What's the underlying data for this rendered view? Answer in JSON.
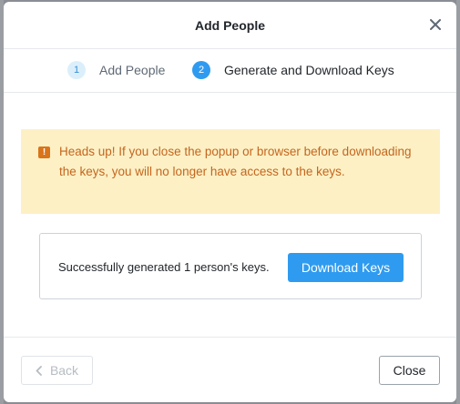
{
  "modal": {
    "title": "Add People",
    "close_icon": "close-icon"
  },
  "stepper": {
    "steps": [
      {
        "number": "1",
        "label": "Add People",
        "state": "completed"
      },
      {
        "number": "2",
        "label": "Generate and Download Keys",
        "state": "active"
      }
    ]
  },
  "warning": {
    "icon": "exclamation-icon",
    "text": "Heads up! If you close the popup or browser before downloading the keys, you will no longer have access to the keys."
  },
  "result": {
    "text": "Successfully generated 1 person's keys.",
    "download_label": "Download Keys"
  },
  "footer": {
    "back_label": "Back",
    "back_icon": "chevron-left-icon",
    "close_label": "Close"
  },
  "colors": {
    "accent": "#2f9bf0",
    "warning_bg": "#fdf0c5",
    "warning_text": "#c4661e",
    "warning_icon": "#d9741a"
  }
}
